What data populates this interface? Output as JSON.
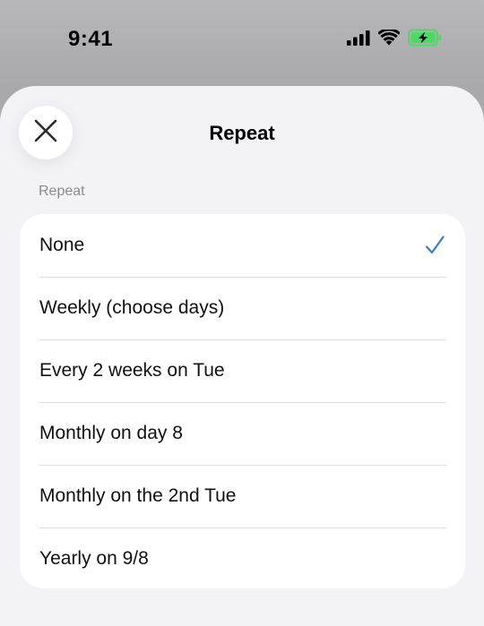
{
  "status_bar": {
    "time": "9:41",
    "icons": [
      "signal-icon",
      "wifi-icon",
      "battery-charging-icon"
    ],
    "battery_color": "#4cd964"
  },
  "sheet": {
    "title": "Repeat",
    "close_icon": "close-icon",
    "section_label": "Repeat",
    "options": [
      {
        "label": "None",
        "selected": true
      },
      {
        "label": "Weekly (choose days)",
        "selected": false
      },
      {
        "label": "Every 2 weeks on Tue",
        "selected": false
      },
      {
        "label": "Monthly on day 8",
        "selected": false
      },
      {
        "label": "Monthly on the 2nd Tue",
        "selected": false
      },
      {
        "label": "Yearly on 9/8",
        "selected": false
      }
    ],
    "accent_color": "#2f7fd6"
  }
}
